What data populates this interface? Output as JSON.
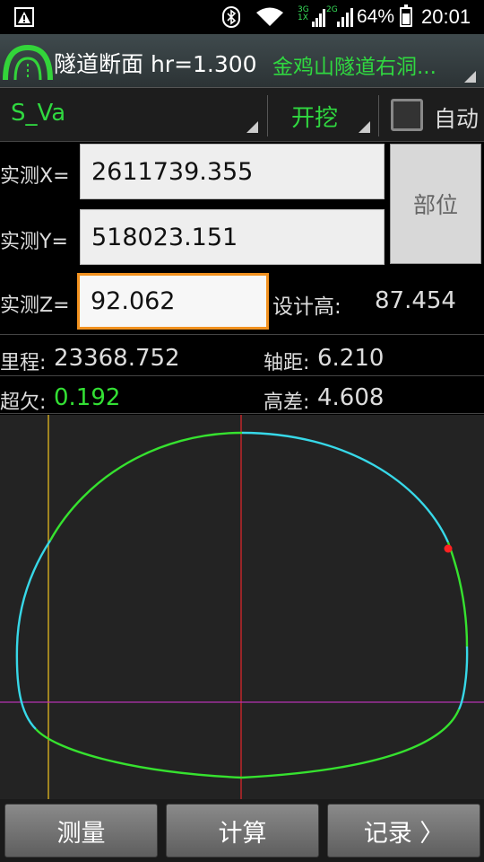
{
  "status": {
    "net_top": "3G",
    "net_bottom": "1X",
    "net2": "2G",
    "battery": "64%",
    "battery_level": 0.64,
    "time": "20:01"
  },
  "header": {
    "title": "隧道断面 hr=1.300",
    "project": "金鸡山隧道右洞..."
  },
  "selectors": {
    "section": "S_Va",
    "mode": "开挖",
    "auto_label": "自动",
    "auto_checked": false
  },
  "form": {
    "x_label": "实测X=",
    "x_value": "2611739.355",
    "y_label": "实测Y=",
    "y_value": "518023.151",
    "z_label": "实测Z=",
    "z_value": "92.062",
    "part_button": "部位",
    "design_height_label": "设计高:",
    "design_height_value": "87.454"
  },
  "results": {
    "mileage_label": "里程:",
    "mileage_value": "23368.752",
    "axis_dist_label": "轴距:",
    "axis_dist_value": "6.210",
    "over_under_label": "超欠:",
    "over_under_value": "0.192",
    "height_diff_label": "高差:",
    "height_diff_value": "4.608"
  },
  "plot": {
    "colors": {
      "profile_green": "#36e22f",
      "profile_cyan": "#37d8e8",
      "axis_red": "#c0262b",
      "axis_yellow": "#c9a51f",
      "level_magenta": "#b531b2",
      "point": "#ff2222"
    }
  },
  "buttons": {
    "measure": "测量",
    "compute": "计算",
    "record": "记录 〉"
  }
}
